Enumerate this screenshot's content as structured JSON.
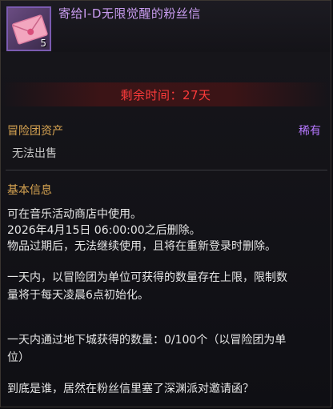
{
  "item": {
    "name": "寄给I-D无限觉醒的粉丝信",
    "count": "5",
    "icon": "envelope-icon",
    "rarity_color": "#b678ff"
  },
  "remaining_time": "剩余时间：27天",
  "property": {
    "label": "冒险团资产",
    "rarity": "稀有",
    "sell_status": "无法出售"
  },
  "basic_info": {
    "title": "基本信息",
    "lines": [
      "可在音乐活动商店中使用。",
      "2026年4月15日 06:00:00之后删除。",
      "物品过期后，无法继续使用，且将在重新登录时删除。",
      "一天内，以冒险团为单位可获得的数量存在上限，限制数",
      "量将于每天凌晨6点初始化。",
      "一天内通过地下城获得的数量：0/100个（以冒险团为单",
      "位）",
      "到底是谁，居然在粉丝信里塞了深渊派对邀请函？"
    ]
  },
  "colors": {
    "title": "#c99cf0",
    "warning": "#ff3b3b",
    "section": "#d8a552",
    "text": "#e6e6e6"
  }
}
